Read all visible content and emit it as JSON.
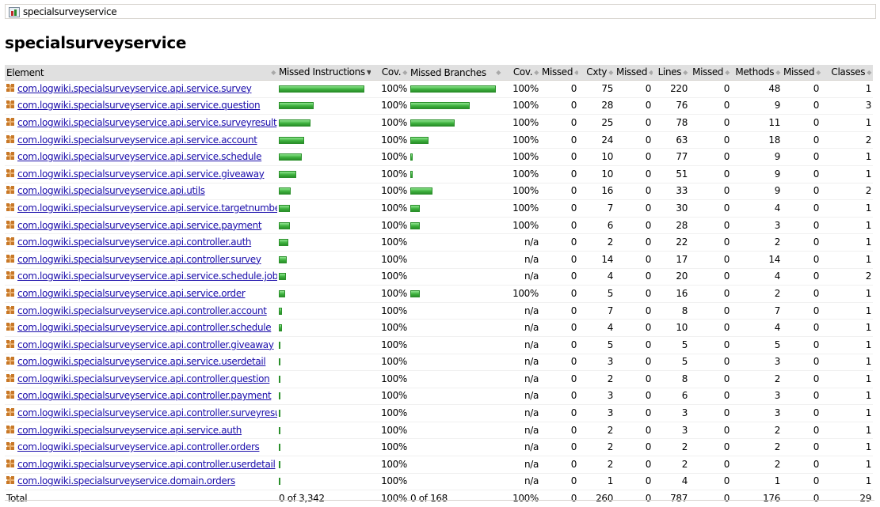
{
  "breadcrumb": {
    "label": "specialsurveyservice",
    "icon": "report-icon"
  },
  "title": "specialsurveyservice",
  "columns": [
    "Element",
    "Missed Instructions",
    "Cov.",
    "Missed Branches",
    "Cov.",
    "Missed",
    "Cxty",
    "Missed",
    "Lines",
    "Missed",
    "Methods",
    "Missed",
    "Classes"
  ],
  "rows": [
    {
      "name": "com.logwiki.specialsurveyservice.api.service.survey",
      "instr_bar": 1.0,
      "instr_cov": "100%",
      "branch_bar": 1.0,
      "branch_cov": "100%",
      "cxty_missed": "0",
      "cxty": "75",
      "lines_missed": "0",
      "lines": "220",
      "methods_missed": "0",
      "methods": "48",
      "classes_missed": "0",
      "classes": "1"
    },
    {
      "name": "com.logwiki.specialsurveyservice.api.service.question",
      "instr_bar": 0.41,
      "instr_cov": "100%",
      "branch_bar": 0.69,
      "branch_cov": "100%",
      "cxty_missed": "0",
      "cxty": "28",
      "lines_missed": "0",
      "lines": "76",
      "methods_missed": "0",
      "methods": "9",
      "classes_missed": "0",
      "classes": "3"
    },
    {
      "name": "com.logwiki.specialsurveyservice.api.service.surveyresult",
      "instr_bar": 0.37,
      "instr_cov": "100%",
      "branch_bar": 0.52,
      "branch_cov": "100%",
      "cxty_missed": "0",
      "cxty": "25",
      "lines_missed": "0",
      "lines": "78",
      "methods_missed": "0",
      "methods": "11",
      "classes_missed": "0",
      "classes": "1"
    },
    {
      "name": "com.logwiki.specialsurveyservice.api.service.account",
      "instr_bar": 0.3,
      "instr_cov": "100%",
      "branch_bar": 0.21,
      "branch_cov": "100%",
      "cxty_missed": "0",
      "cxty": "24",
      "lines_missed": "0",
      "lines": "63",
      "methods_missed": "0",
      "methods": "18",
      "classes_missed": "0",
      "classes": "2"
    },
    {
      "name": "com.logwiki.specialsurveyservice.api.service.schedule",
      "instr_bar": 0.27,
      "instr_cov": "100%",
      "branch_bar": 0.03,
      "branch_cov": "100%",
      "cxty_missed": "0",
      "cxty": "10",
      "lines_missed": "0",
      "lines": "77",
      "methods_missed": "0",
      "methods": "9",
      "classes_missed": "0",
      "classes": "1"
    },
    {
      "name": "com.logwiki.specialsurveyservice.api.service.giveaway",
      "instr_bar": 0.2,
      "instr_cov": "100%",
      "branch_bar": 0.03,
      "branch_cov": "100%",
      "cxty_missed": "0",
      "cxty": "10",
      "lines_missed": "0",
      "lines": "51",
      "methods_missed": "0",
      "methods": "9",
      "classes_missed": "0",
      "classes": "1"
    },
    {
      "name": "com.logwiki.specialsurveyservice.api.utils",
      "instr_bar": 0.14,
      "instr_cov": "100%",
      "branch_bar": 0.26,
      "branch_cov": "100%",
      "cxty_missed": "0",
      "cxty": "16",
      "lines_missed": "0",
      "lines": "33",
      "methods_missed": "0",
      "methods": "9",
      "classes_missed": "0",
      "classes": "2"
    },
    {
      "name": "com.logwiki.specialsurveyservice.api.service.targetnumber",
      "instr_bar": 0.13,
      "instr_cov": "100%",
      "branch_bar": 0.11,
      "branch_cov": "100%",
      "cxty_missed": "0",
      "cxty": "7",
      "lines_missed": "0",
      "lines": "30",
      "methods_missed": "0",
      "methods": "4",
      "classes_missed": "0",
      "classes": "1"
    },
    {
      "name": "com.logwiki.specialsurveyservice.api.service.payment",
      "instr_bar": 0.13,
      "instr_cov": "100%",
      "branch_bar": 0.11,
      "branch_cov": "100%",
      "cxty_missed": "0",
      "cxty": "6",
      "lines_missed": "0",
      "lines": "28",
      "methods_missed": "0",
      "methods": "3",
      "classes_missed": "0",
      "classes": "1"
    },
    {
      "name": "com.logwiki.specialsurveyservice.api.controller.auth",
      "instr_bar": 0.11,
      "instr_cov": "100%",
      "branch_bar": 0,
      "branch_cov": "n/a",
      "cxty_missed": "0",
      "cxty": "2",
      "lines_missed": "0",
      "lines": "22",
      "methods_missed": "0",
      "methods": "2",
      "classes_missed": "0",
      "classes": "1"
    },
    {
      "name": "com.logwiki.specialsurveyservice.api.controller.survey",
      "instr_bar": 0.09,
      "instr_cov": "100%",
      "branch_bar": 0,
      "branch_cov": "n/a",
      "cxty_missed": "0",
      "cxty": "14",
      "lines_missed": "0",
      "lines": "17",
      "methods_missed": "0",
      "methods": "14",
      "classes_missed": "0",
      "classes": "1"
    },
    {
      "name": "com.logwiki.specialsurveyservice.api.service.schedule.job",
      "instr_bar": 0.08,
      "instr_cov": "100%",
      "branch_bar": 0,
      "branch_cov": "n/a",
      "cxty_missed": "0",
      "cxty": "4",
      "lines_missed": "0",
      "lines": "20",
      "methods_missed": "0",
      "methods": "4",
      "classes_missed": "0",
      "classes": "2"
    },
    {
      "name": "com.logwiki.specialsurveyservice.api.service.order",
      "instr_bar": 0.07,
      "instr_cov": "100%",
      "branch_bar": 0.11,
      "branch_cov": "100%",
      "cxty_missed": "0",
      "cxty": "5",
      "lines_missed": "0",
      "lines": "16",
      "methods_missed": "0",
      "methods": "2",
      "classes_missed": "0",
      "classes": "1"
    },
    {
      "name": "com.logwiki.specialsurveyservice.api.controller.account",
      "instr_bar": 0.04,
      "instr_cov": "100%",
      "branch_bar": 0,
      "branch_cov": "n/a",
      "cxty_missed": "0",
      "cxty": "7",
      "lines_missed": "0",
      "lines": "8",
      "methods_missed": "0",
      "methods": "7",
      "classes_missed": "0",
      "classes": "1"
    },
    {
      "name": "com.logwiki.specialsurveyservice.api.controller.schedule",
      "instr_bar": 0.035,
      "instr_cov": "100%",
      "branch_bar": 0,
      "branch_cov": "n/a",
      "cxty_missed": "0",
      "cxty": "4",
      "lines_missed": "0",
      "lines": "10",
      "methods_missed": "0",
      "methods": "4",
      "classes_missed": "0",
      "classes": "1"
    },
    {
      "name": "com.logwiki.specialsurveyservice.api.controller.giveaway",
      "instr_bar": 0.02,
      "instr_cov": "100%",
      "branch_bar": 0,
      "branch_cov": "n/a",
      "cxty_missed": "0",
      "cxty": "5",
      "lines_missed": "0",
      "lines": "5",
      "methods_missed": "0",
      "methods": "5",
      "classes_missed": "0",
      "classes": "1"
    },
    {
      "name": "com.logwiki.specialsurveyservice.api.service.userdetail",
      "instr_bar": 0.02,
      "instr_cov": "100%",
      "branch_bar": 0,
      "branch_cov": "n/a",
      "cxty_missed": "0",
      "cxty": "3",
      "lines_missed": "0",
      "lines": "5",
      "methods_missed": "0",
      "methods": "3",
      "classes_missed": "0",
      "classes": "1"
    },
    {
      "name": "com.logwiki.specialsurveyservice.api.controller.question",
      "instr_bar": 0.02,
      "instr_cov": "100%",
      "branch_bar": 0,
      "branch_cov": "n/a",
      "cxty_missed": "0",
      "cxty": "2",
      "lines_missed": "0",
      "lines": "8",
      "methods_missed": "0",
      "methods": "2",
      "classes_missed": "0",
      "classes": "1"
    },
    {
      "name": "com.logwiki.specialsurveyservice.api.controller.payment",
      "instr_bar": 0.02,
      "instr_cov": "100%",
      "branch_bar": 0,
      "branch_cov": "n/a",
      "cxty_missed": "0",
      "cxty": "3",
      "lines_missed": "0",
      "lines": "6",
      "methods_missed": "0",
      "methods": "3",
      "classes_missed": "0",
      "classes": "1"
    },
    {
      "name": "com.logwiki.specialsurveyservice.api.controller.surveyresult",
      "instr_bar": 0.02,
      "instr_cov": "100%",
      "branch_bar": 0,
      "branch_cov": "n/a",
      "cxty_missed": "0",
      "cxty": "3",
      "lines_missed": "0",
      "lines": "3",
      "methods_missed": "0",
      "methods": "3",
      "classes_missed": "0",
      "classes": "1"
    },
    {
      "name": "com.logwiki.specialsurveyservice.api.service.auth",
      "instr_bar": 0.015,
      "instr_cov": "100%",
      "branch_bar": 0,
      "branch_cov": "n/a",
      "cxty_missed": "0",
      "cxty": "2",
      "lines_missed": "0",
      "lines": "3",
      "methods_missed": "0",
      "methods": "2",
      "classes_missed": "0",
      "classes": "1"
    },
    {
      "name": "com.logwiki.specialsurveyservice.api.controller.orders",
      "instr_bar": 0.015,
      "instr_cov": "100%",
      "branch_bar": 0,
      "branch_cov": "n/a",
      "cxty_missed": "0",
      "cxty": "2",
      "lines_missed": "0",
      "lines": "2",
      "methods_missed": "0",
      "methods": "2",
      "classes_missed": "0",
      "classes": "1"
    },
    {
      "name": "com.logwiki.specialsurveyservice.api.controller.userdetail",
      "instr_bar": 0.015,
      "instr_cov": "100%",
      "branch_bar": 0,
      "branch_cov": "n/a",
      "cxty_missed": "0",
      "cxty": "2",
      "lines_missed": "0",
      "lines": "2",
      "methods_missed": "0",
      "methods": "2",
      "classes_missed": "0",
      "classes": "1"
    },
    {
      "name": "com.logwiki.specialsurveyservice.domain.orders",
      "instr_bar": 0.01,
      "instr_cov": "100%",
      "branch_bar": 0,
      "branch_cov": "n/a",
      "cxty_missed": "0",
      "cxty": "1",
      "lines_missed": "0",
      "lines": "4",
      "methods_missed": "0",
      "methods": "1",
      "classes_missed": "0",
      "classes": "1"
    }
  ],
  "total": {
    "label": "Total",
    "instr": "0 of 3,342",
    "instr_cov": "100%",
    "branch": "0 of 168",
    "branch_cov": "100%",
    "cxty_missed": "0",
    "cxty": "260",
    "lines_missed": "0",
    "lines": "787",
    "methods_missed": "0",
    "methods": "176",
    "classes_missed": "0",
    "classes": "29"
  },
  "colors": {
    "bar_green": "#3db03d",
    "link": "#1a0dab",
    "header_bg": "#e0e0e0"
  }
}
